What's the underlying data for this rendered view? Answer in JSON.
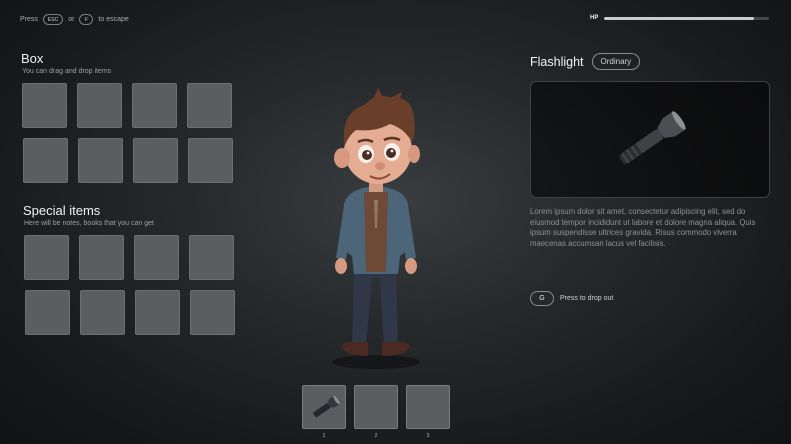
{
  "hint": {
    "press": "Press",
    "key_escape": "ESC",
    "or": "or",
    "key_f": "F",
    "to_escape": "to escape"
  },
  "hp": {
    "label": "HP",
    "value_fraction": 0.91
  },
  "box": {
    "title": "Box",
    "subtitle": "You can drag and drop items"
  },
  "special": {
    "title": "Special items",
    "subtitle": "Here will be notes, books that you can get"
  },
  "item": {
    "name": "Flashlight",
    "rarity": "Ordinary",
    "icon": "flashlight-icon",
    "description": "Lorem ipsum dolor sit amet, consectetur adipiscing elit, sed do eiusmod tempor incididunt ut labore et dolore magna aliqua. Quis ipsum suspendisse ultrices gravida. Risus commodo viverra maecenas accumsan lacus vel facilisis."
  },
  "drop": {
    "key": "G",
    "label": "Press to drop out"
  },
  "hotbar": {
    "slots": [
      {
        "number": "1",
        "item_icon": "flashlight-icon"
      },
      {
        "number": "2"
      },
      {
        "number": "3"
      }
    ]
  },
  "colors": {
    "background": "#1a1b1d",
    "slot": "#5b5e60",
    "accent": "#c9cbcd"
  }
}
